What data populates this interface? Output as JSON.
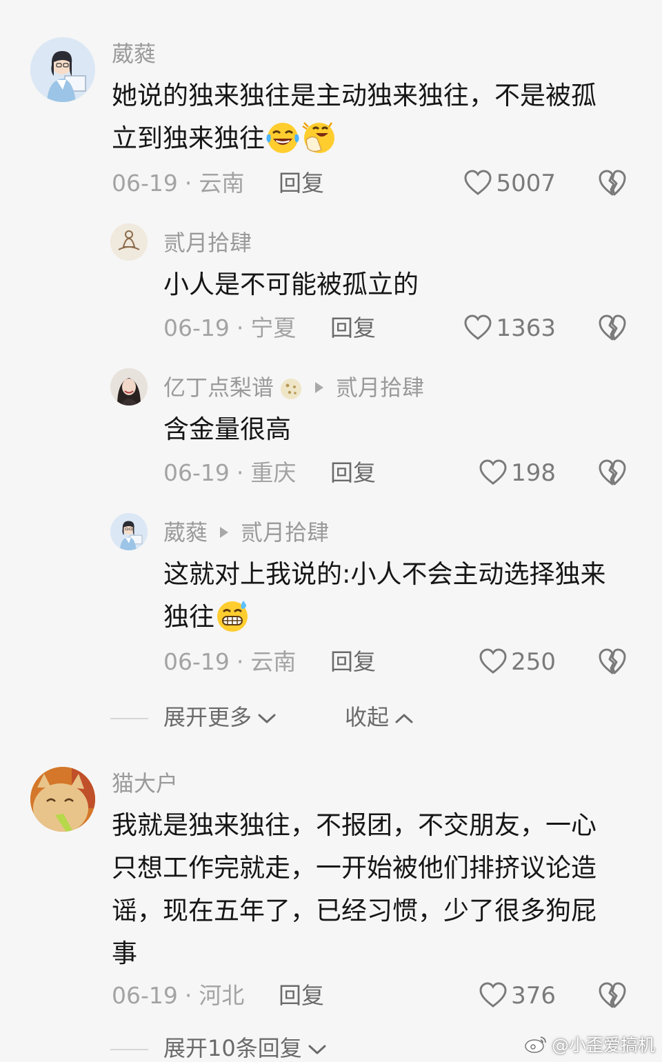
{
  "comments": [
    {
      "username": "葳蕤",
      "text": "她说的独来独往是主动独来独往，不是被孤立到独来独往",
      "emojis": [
        "crying-laughing-emoji",
        "hand-over-face-laughing-emoji"
      ],
      "date": "06-19",
      "location": "云南",
      "reply_label": "回复",
      "likes": "5007"
    },
    {
      "username": "贰月拾肆",
      "text": "小人是不可能被孤立的",
      "date": "06-19",
      "location": "宁夏",
      "reply_label": "回复",
      "likes": "1363"
    },
    {
      "username": "亿丁点梨谱",
      "reply_to": "贰月拾肆",
      "text": "含金量很高",
      "date": "06-19",
      "location": "重庆",
      "reply_label": "回复",
      "likes": "198"
    },
    {
      "username": "葳蕤",
      "reply_to": "贰月拾肆",
      "text": "这就对上我说的:小人不会主动选择独来独往",
      "emojis": [
        "grinning-sweat-emoji"
      ],
      "date": "06-19",
      "location": "云南",
      "reply_label": "回复",
      "likes": "250"
    },
    {
      "username": "猫大户",
      "text": "我就是独来独往，不报团，不交朋友，一心只想工作完就走，一开始被他们排挤议论造谣，现在五年了，已经习惯，少了很多狗屁事",
      "date": "06-19",
      "location": "河北",
      "reply_label": "回复",
      "likes": "376"
    }
  ],
  "thread_controls": {
    "expand_more": "展开更多",
    "collapse": "收起",
    "expand_replies": "展开10条回复"
  },
  "watermark": "@小歪爱搞机",
  "icons": {
    "like": "heart-outline-icon",
    "dislike": "broken-heart-icon",
    "expand": "chevron-down-icon",
    "collapse": "chevron-up-icon"
  }
}
